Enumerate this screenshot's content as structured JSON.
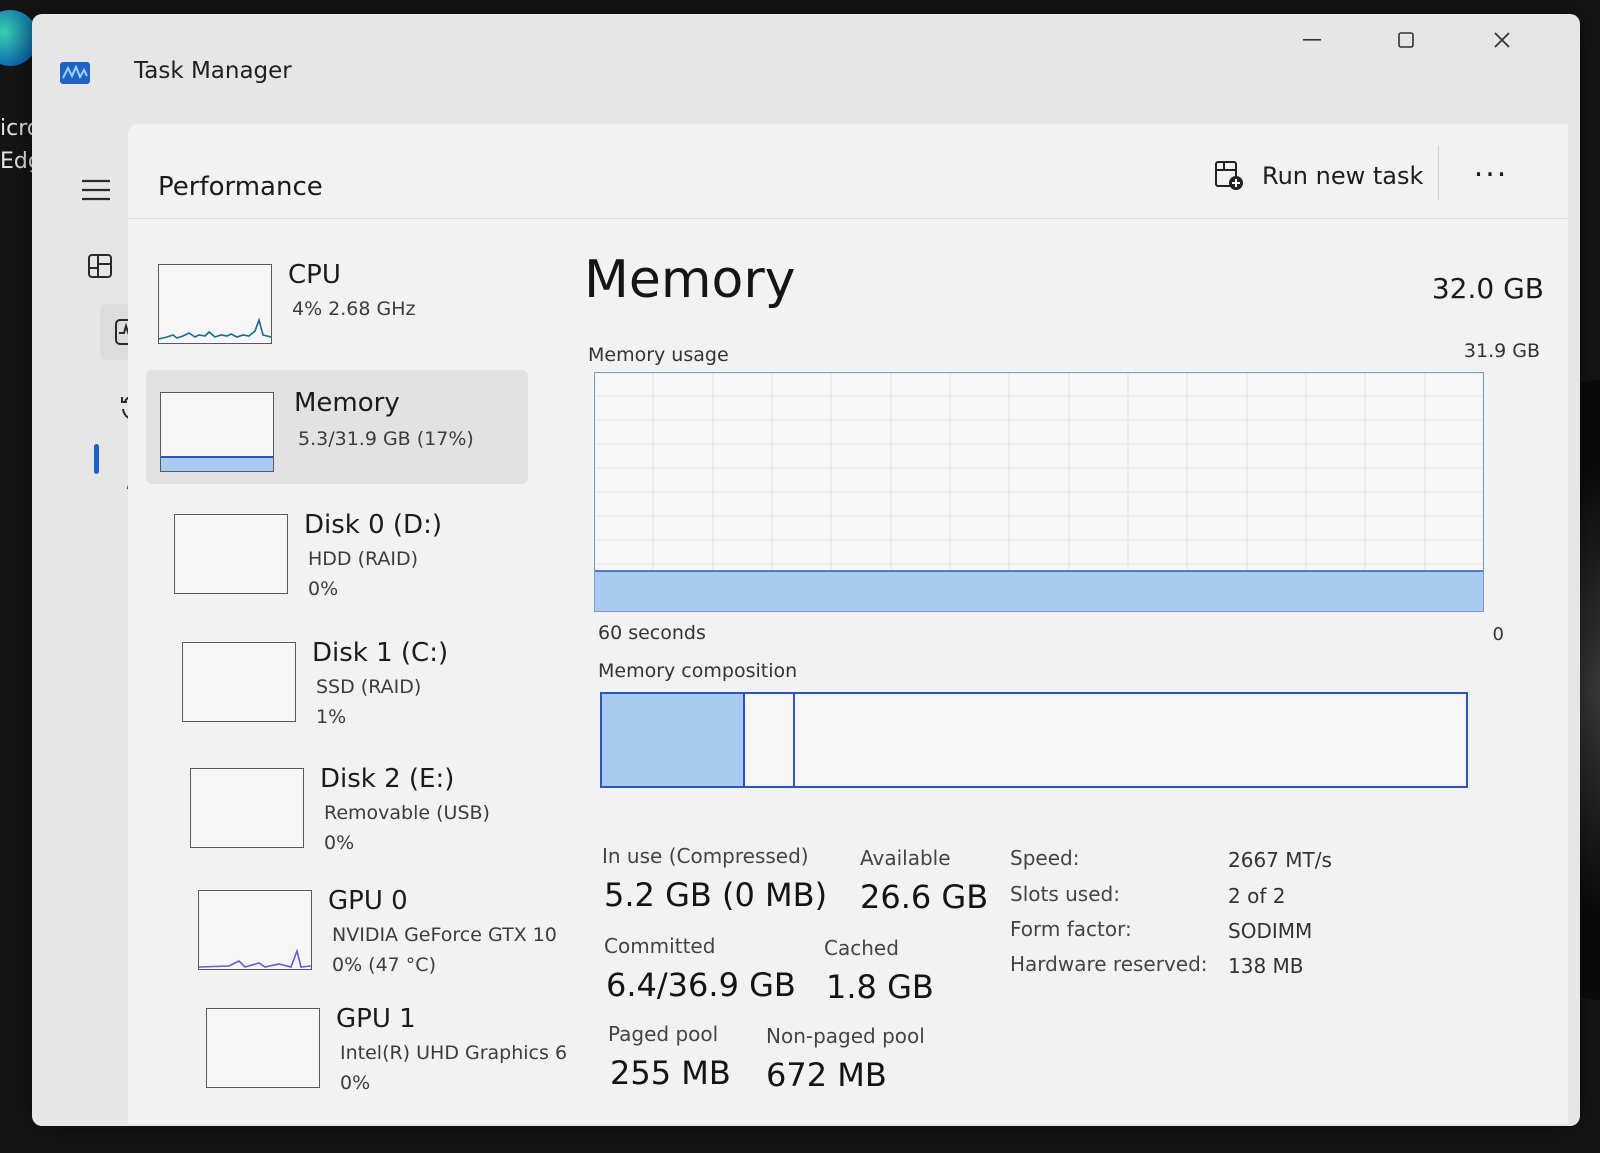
{
  "desktop": {
    "shortcut_label_line1": "icro",
    "shortcut_label_line2": "Edg"
  },
  "window": {
    "title": "Task Manager"
  },
  "commandbar": {
    "page_title": "Performance",
    "run_new_task": "Run new task",
    "more": "..."
  },
  "colors": {
    "accent": "#1e63c4",
    "memory_fill": "#a9cbf2",
    "memory_line": "#2a55c0",
    "cpu_line": "#1a6a8a",
    "gpu_line": "#6a5ad0"
  },
  "nav": [
    {
      "name": "menu",
      "icon": "hamburger-icon"
    },
    {
      "name": "processes",
      "icon": "processes-icon"
    },
    {
      "name": "performance",
      "icon": "performance-icon",
      "active": true
    },
    {
      "name": "app-history",
      "icon": "history-icon"
    },
    {
      "name": "startup-apps",
      "icon": "startup-icon"
    },
    {
      "name": "users",
      "icon": "users-icon"
    },
    {
      "name": "details",
      "icon": "details-icon"
    },
    {
      "name": "services",
      "icon": "services-icon"
    },
    {
      "name": "settings",
      "icon": "gear-icon"
    }
  ],
  "devices": [
    {
      "name": "CPU",
      "line1": "4%  2.68 GHz",
      "line2": ""
    },
    {
      "name": "Memory",
      "line1": "5.3/31.9 GB (17%)",
      "line2": "",
      "selected": true,
      "usage_fraction": 0.17
    },
    {
      "name": "Disk 0 (D:)",
      "line1": "HDD (RAID)",
      "line2": "0%"
    },
    {
      "name": "Disk 1 (C:)",
      "line1": "SSD (RAID)",
      "line2": "1%"
    },
    {
      "name": "Disk 2 (E:)",
      "line1": "Removable (USB)",
      "line2": "0%"
    },
    {
      "name": "GPU 0",
      "line1": "NVIDIA GeForce GTX 10",
      "line2": "0%  (47 °C)"
    },
    {
      "name": "GPU 1",
      "line1": "Intel(R) UHD Graphics 6",
      "line2": "0%"
    }
  ],
  "memory": {
    "title": "Memory",
    "total": "32.0 GB",
    "usage_label": "Memory usage",
    "usage_max": "31.9 GB",
    "axis_left": "60 seconds",
    "axis_right": "0",
    "composition_label": "Memory composition",
    "usage_fraction": 0.17,
    "composition": {
      "in_use_fraction": 0.163,
      "modified_fraction": 0.055
    },
    "stats": {
      "in_use_label": "In use (Compressed)",
      "in_use_value": "5.2 GB (0 MB)",
      "available_label": "Available",
      "available_value": "26.6 GB",
      "committed_label": "Committed",
      "committed_value": "6.4/36.9 GB",
      "cached_label": "Cached",
      "cached_value": "1.8 GB",
      "paged_label": "Paged pool",
      "paged_value": "255 MB",
      "nonpaged_label": "Non-paged pool",
      "nonpaged_value": "672 MB"
    },
    "details": [
      {
        "key": "Speed:",
        "value": "2667 MT/s"
      },
      {
        "key": "Slots used:",
        "value": "2 of 2"
      },
      {
        "key": "Form factor:",
        "value": "SODIMM"
      },
      {
        "key": "Hardware reserved:",
        "value": "138 MB"
      }
    ]
  }
}
